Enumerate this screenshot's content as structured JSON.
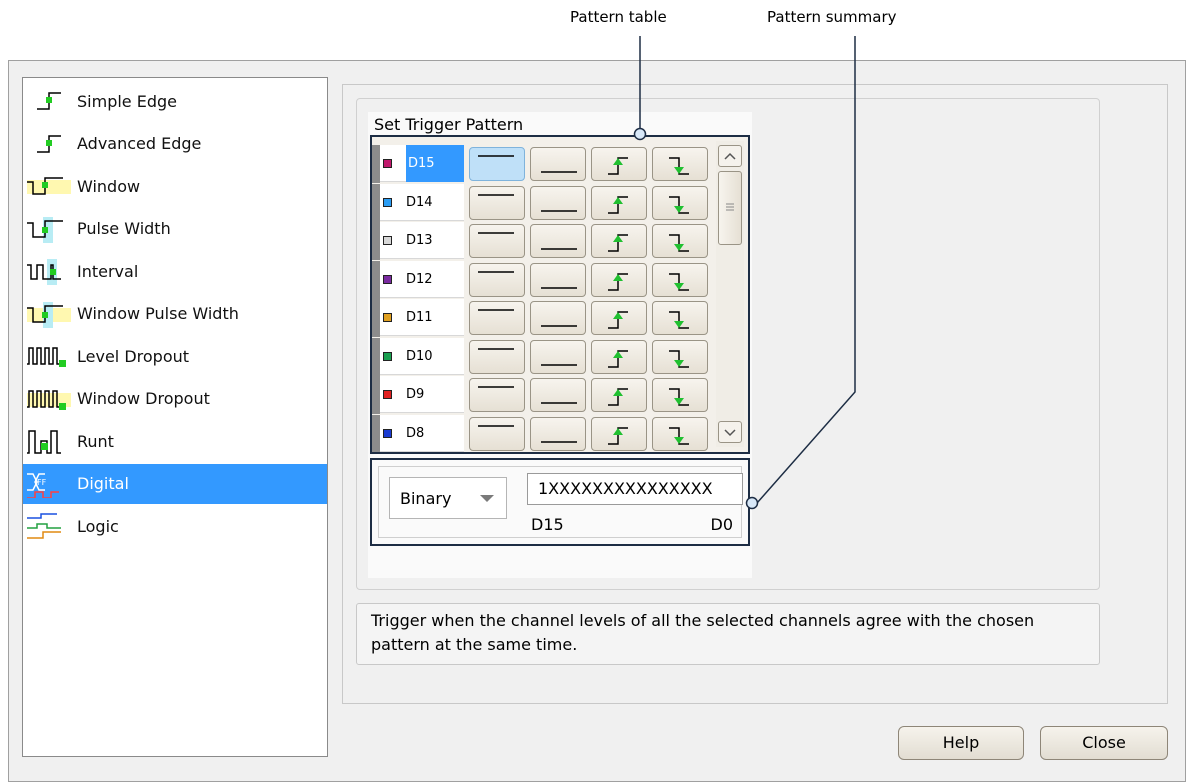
{
  "callouts": {
    "pattern_table": "Pattern table",
    "pattern_summary": "Pattern summary"
  },
  "trigger_types": [
    {
      "label": "Simple Edge",
      "icon": "simple-edge-icon"
    },
    {
      "label": "Advanced Edge",
      "icon": "advanced-edge-icon"
    },
    {
      "label": "Window",
      "icon": "window-icon"
    },
    {
      "label": "Pulse Width",
      "icon": "pulse-width-icon"
    },
    {
      "label": "Interval",
      "icon": "interval-icon"
    },
    {
      "label": "Window Pulse Width",
      "icon": "window-pulse-width-icon"
    },
    {
      "label": "Level Dropout",
      "icon": "level-dropout-icon"
    },
    {
      "label": "Window Dropout",
      "icon": "window-dropout-icon"
    },
    {
      "label": "Runt",
      "icon": "runt-icon"
    },
    {
      "label": "Digital",
      "icon": "digital-icon",
      "selected": true
    },
    {
      "label": "Logic",
      "icon": "logic-icon"
    }
  ],
  "set_trigger_pattern_label": "Set Trigger Pattern",
  "channels": [
    {
      "name": "D15",
      "color": "#c0186c",
      "selected": true
    },
    {
      "name": "D14",
      "color": "#2a9df4"
    },
    {
      "name": "D13",
      "color": "#d8d8d8"
    },
    {
      "name": "D12",
      "color": "#7a2aa0"
    },
    {
      "name": "D11",
      "color": "#e0a020"
    },
    {
      "name": "D10",
      "color": "#1aa050"
    },
    {
      "name": "D9",
      "color": "#e02020"
    },
    {
      "name": "D8",
      "color": "#1a3ad0"
    }
  ],
  "pattern_buttons": [
    "high-level-icon",
    "low-level-icon",
    "rising-edge-icon",
    "falling-edge-icon"
  ],
  "summary": {
    "format": "Binary",
    "pattern": "1XXXXXXXXXXXXXXX",
    "msb_label": "D15",
    "lsb_label": "D0"
  },
  "description": "Trigger when the channel levels of all the selected channels agree with the chosen pattern at the same time.",
  "buttons": {
    "help": "Help",
    "close": "Close"
  }
}
